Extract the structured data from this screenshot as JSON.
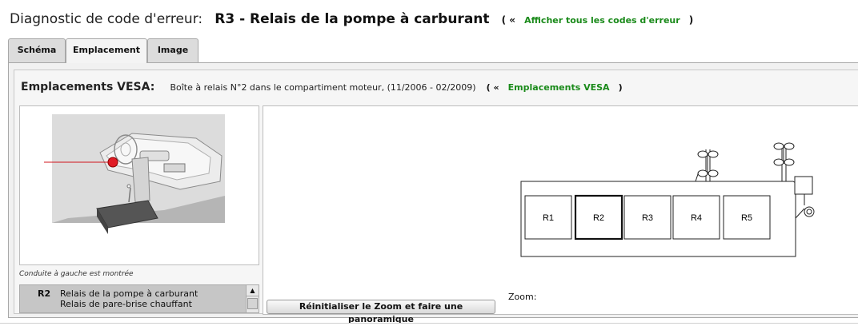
{
  "header": {
    "prefix": "Diagnostic de code d'erreur:",
    "code": "R3 - Relais de la pompe à carburant",
    "open_paren": "( «",
    "link": "Afficher tous les codes d'erreur",
    "close_paren": ")"
  },
  "tabs": [
    {
      "label": "Schéma"
    },
    {
      "label": "Emplacement"
    },
    {
      "label": "Image"
    }
  ],
  "vesa": {
    "label": "Emplacements VESA:",
    "description": "Boîte à relais N°2 dans le compartiment moteur, (11/2006 - 02/2009)",
    "open_paren": "( «",
    "link": "Emplacements VESA",
    "close_paren": ")"
  },
  "caption": "Conduite à gauche est montrée",
  "relay_list": {
    "code": "R2",
    "line1": "Relais de la pompe à carburant",
    "line2": "Relais de pare-brise chauffant"
  },
  "diagram": {
    "relays": [
      "R1",
      "R2",
      "R3",
      "R4",
      "R5"
    ],
    "selected": "R2"
  },
  "controls": {
    "reset_label": "Réinitialiser le Zoom et faire une panoramique",
    "zoom_label": "Zoom:"
  }
}
